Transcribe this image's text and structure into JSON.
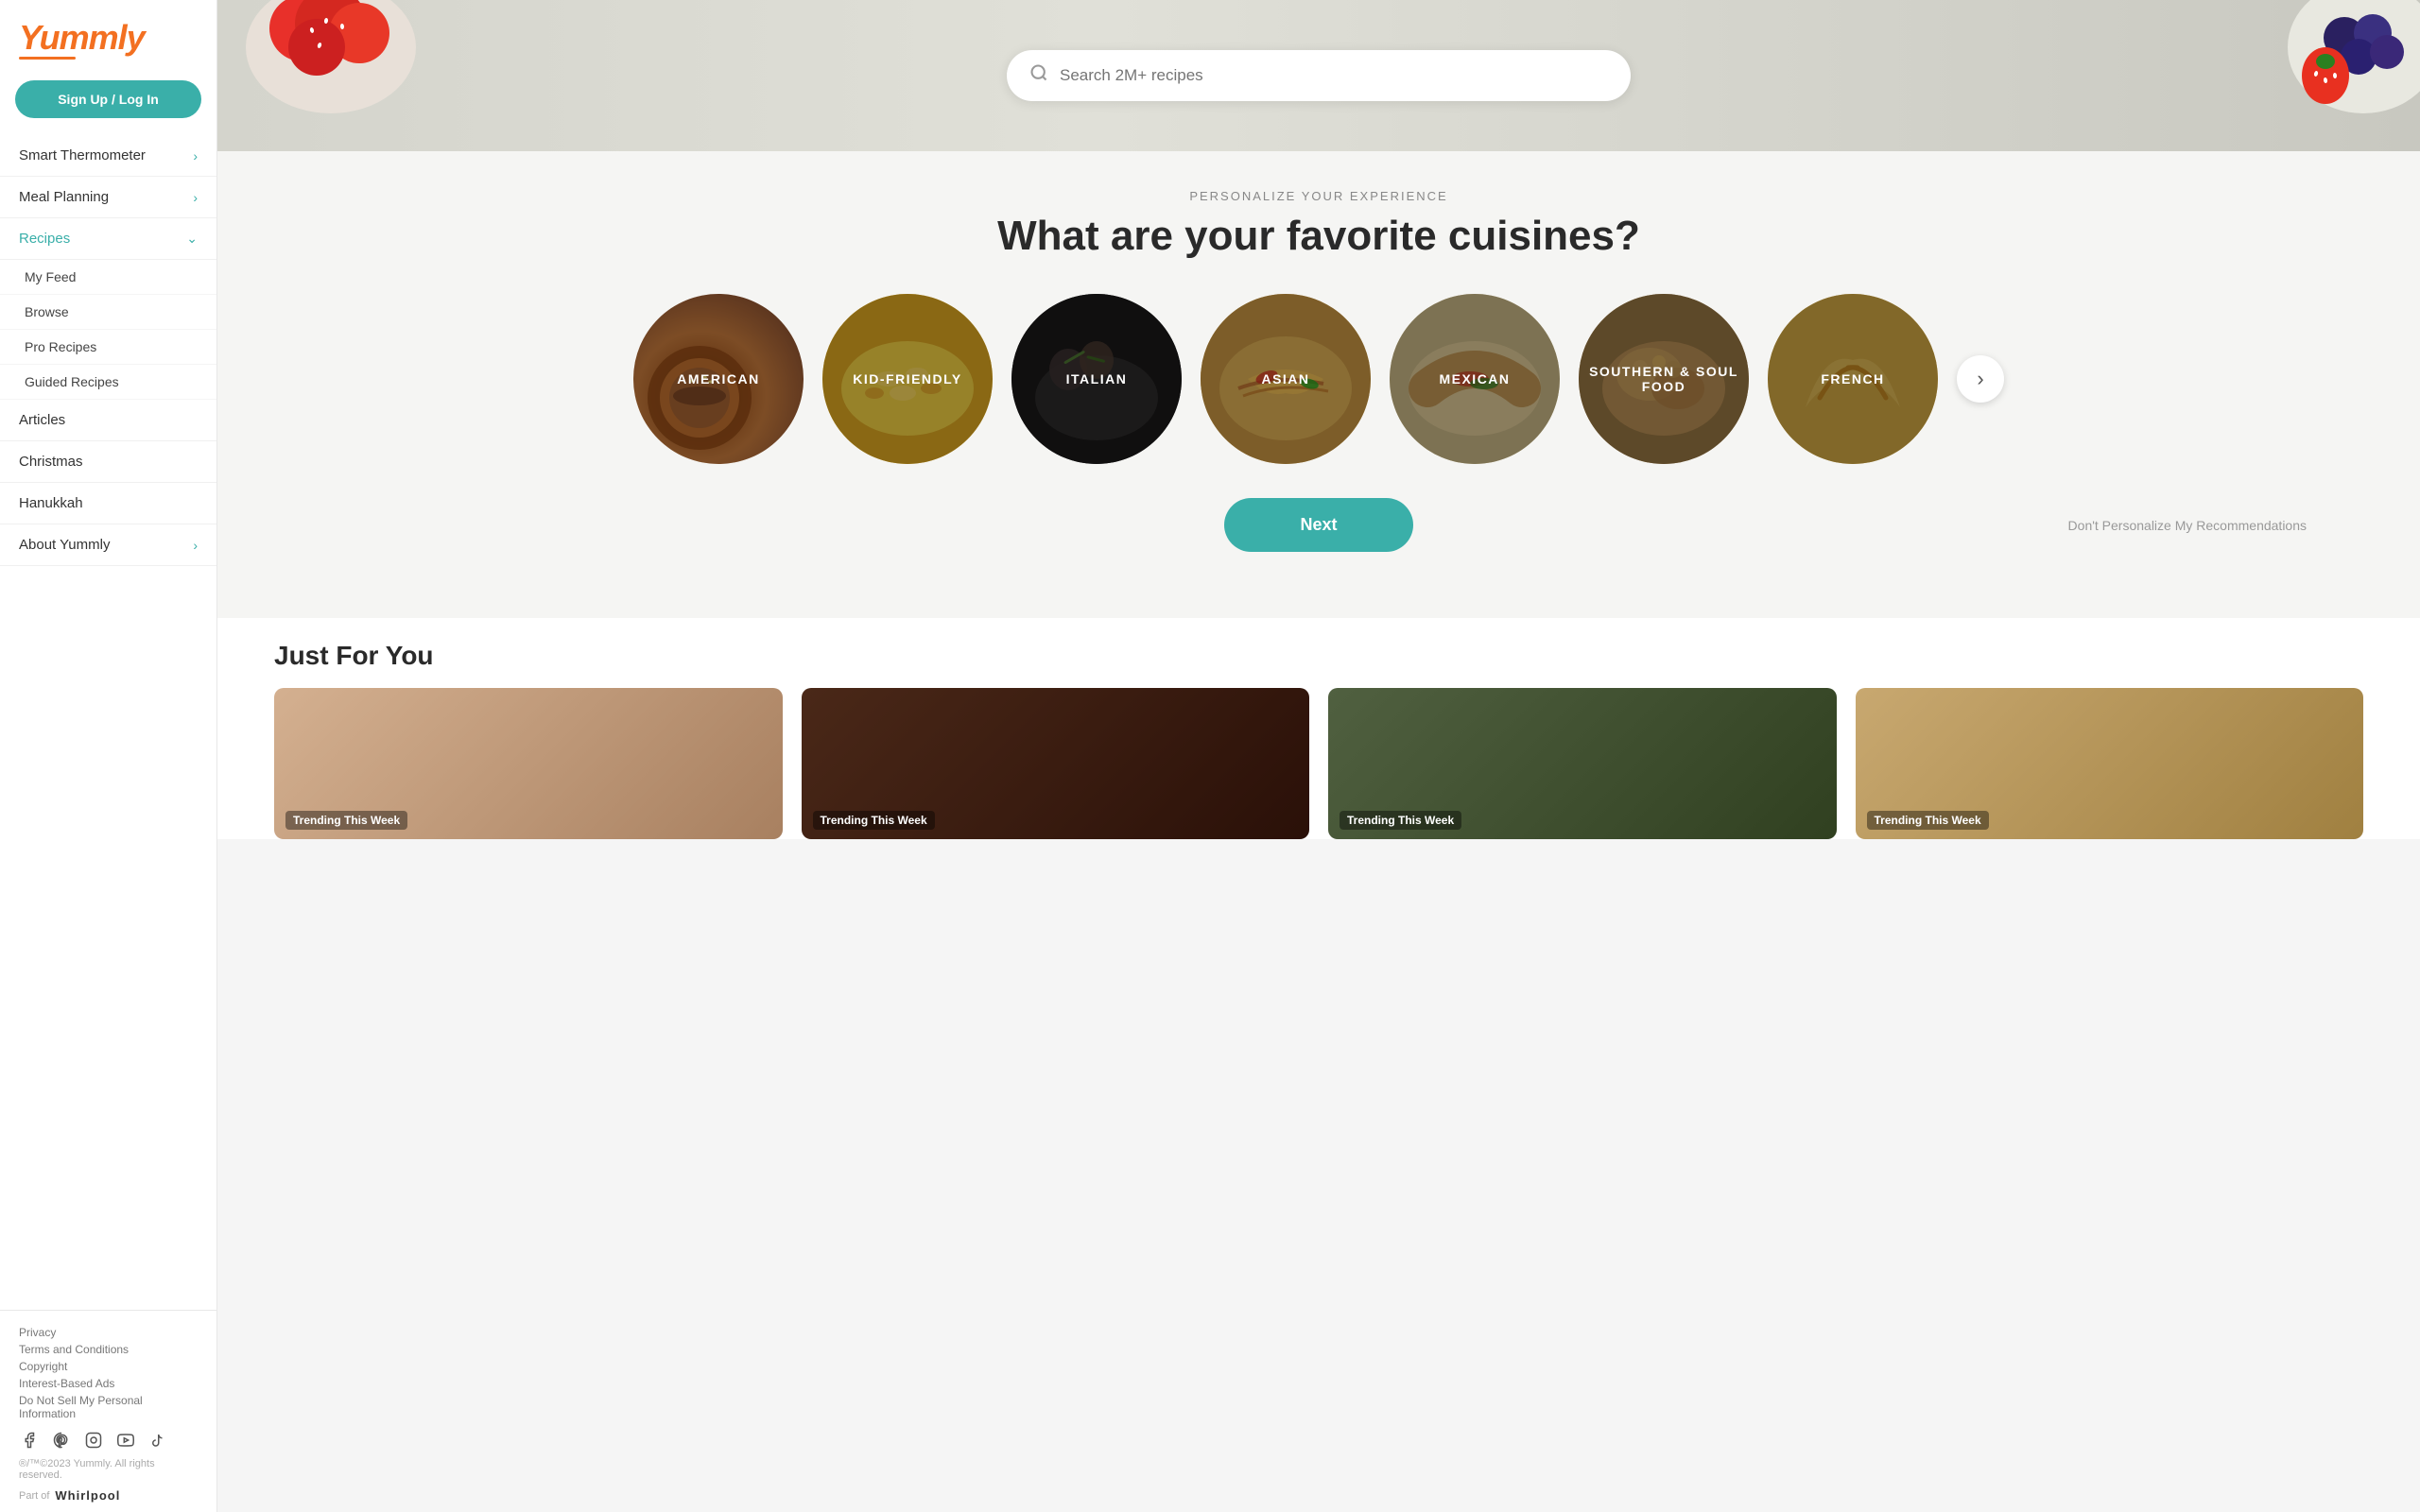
{
  "sidebar": {
    "logo": "Yummly",
    "signup_label": "Sign Up / Log In",
    "nav_items": [
      {
        "id": "smart-thermometer",
        "label": "Smart Thermometer",
        "has_chevron": true,
        "active": false
      },
      {
        "id": "meal-planning",
        "label": "Meal Planning",
        "has_chevron": true,
        "active": false
      },
      {
        "id": "recipes",
        "label": "Recipes",
        "has_chevron": true,
        "active": true,
        "expanded": true
      }
    ],
    "sub_nav_items": [
      {
        "id": "my-feed",
        "label": "My Feed"
      },
      {
        "id": "browse",
        "label": "Browse"
      },
      {
        "id": "pro-recipes",
        "label": "Pro Recipes"
      },
      {
        "id": "guided-recipes",
        "label": "Guided Recipes"
      }
    ],
    "bottom_nav_items": [
      {
        "id": "articles",
        "label": "Articles"
      },
      {
        "id": "christmas",
        "label": "Christmas"
      },
      {
        "id": "hanukkah",
        "label": "Hanukkah"
      },
      {
        "id": "about-yummly",
        "label": "About Yummly",
        "has_chevron": true
      }
    ],
    "footer_links": [
      {
        "id": "privacy",
        "label": "Privacy"
      },
      {
        "id": "terms",
        "label": "Terms and Conditions"
      },
      {
        "id": "copyright",
        "label": "Copyright"
      },
      {
        "id": "interest-ads",
        "label": "Interest-Based Ads"
      },
      {
        "id": "do-not-sell",
        "label": "Do Not Sell My Personal Information"
      }
    ],
    "social_icons": [
      {
        "id": "facebook",
        "symbol": "f"
      },
      {
        "id": "pinterest",
        "symbol": "P"
      },
      {
        "id": "instagram",
        "symbol": "◎"
      },
      {
        "id": "youtube",
        "symbol": "▶"
      },
      {
        "id": "tiktok",
        "symbol": "♪"
      }
    ],
    "copyright_text": "®/™©2023 Yummly. All rights reserved.",
    "part_of": "Part of",
    "whirlpool": "Whirlpool"
  },
  "search": {
    "placeholder": "Search 2M+ recipes"
  },
  "personalize": {
    "label": "PERSONALIZE YOUR EXPERIENCE",
    "title": "What are your favorite cuisines?"
  },
  "cuisines": [
    {
      "id": "american",
      "label": "AMERICAN",
      "css_class": "cuisine-american"
    },
    {
      "id": "kid-friendly",
      "label": "KID-FRIENDLY",
      "css_class": "cuisine-kid"
    },
    {
      "id": "italian",
      "label": "ITALIAN",
      "css_class": "cuisine-italian"
    },
    {
      "id": "asian",
      "label": "ASIAN",
      "css_class": "cuisine-asian"
    },
    {
      "id": "mexican",
      "label": "MEXICAN",
      "css_class": "cuisine-mexican"
    },
    {
      "id": "southern-soul",
      "label": "SOUTHERN & SOUL FOOD",
      "css_class": "cuisine-southern"
    },
    {
      "id": "french",
      "label": "FRENCH",
      "css_class": "cuisine-french"
    }
  ],
  "actions": {
    "next_label": "Next",
    "dont_personalize_label": "Don't Personalize My Recommendations"
  },
  "just_for_you": {
    "title": "Just For You",
    "cards": [
      {
        "id": "card1",
        "badge": "Trending This Week"
      },
      {
        "id": "card2",
        "badge": "Trending This Week"
      },
      {
        "id": "card3",
        "badge": "Trending This Week"
      },
      {
        "id": "card4",
        "badge": "Trending This Week"
      }
    ]
  }
}
